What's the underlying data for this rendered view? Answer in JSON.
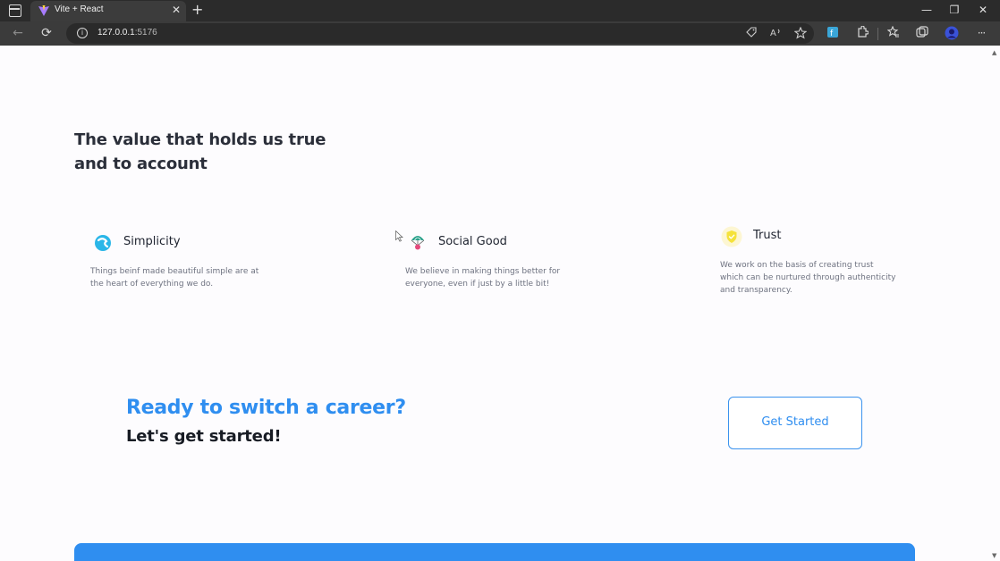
{
  "browser": {
    "tab": {
      "title": "Vite + React",
      "close_glyph": "✕",
      "favicon": "vite-logo-icon"
    },
    "new_tab_glyph": "+",
    "window_controls": {
      "minimize": "—",
      "restore": "❐",
      "close": "✕"
    },
    "nav": {
      "back_glyph": "←",
      "reload_glyph": "⟳"
    },
    "address": {
      "host": "127.0.0.1",
      "port": ":5176",
      "info_glyph": "i"
    },
    "toolbar_icons": [
      "tag-icon",
      "read-aloud-icon",
      "favorite-add-icon",
      "extension-app-icon",
      "extensions-icon",
      "favorites-icon",
      "collections-icon",
      "profile-avatar",
      "more-icon"
    ],
    "more_glyph": "···"
  },
  "page": {
    "heading": "The value that holds us true and to account",
    "values": [
      {
        "title": "Simplicity",
        "description": "Things beinf made beautiful simple are at the heart of everything we do.",
        "icon": "simplicity-icon"
      },
      {
        "title": "Social Good",
        "description": "We believe in making things better for everyone, even if just by a little bit!",
        "icon": "parachute-icon"
      },
      {
        "title": "Trust",
        "description": "We work on the basis of creating trust which can be nurtured through authenticity and transparency.",
        "icon": "shield-check-icon"
      }
    ],
    "cta": {
      "title": "Ready to switch a career?",
      "subtitle": "Let's get started!",
      "button": "Get Started"
    }
  },
  "colors": {
    "accent": "#2f8ef0",
    "heading": "#2b2f3a",
    "body_text": "#6e7280",
    "trust_icon": "#f5e23a",
    "simplicity_icon": "#2ab6e8"
  }
}
